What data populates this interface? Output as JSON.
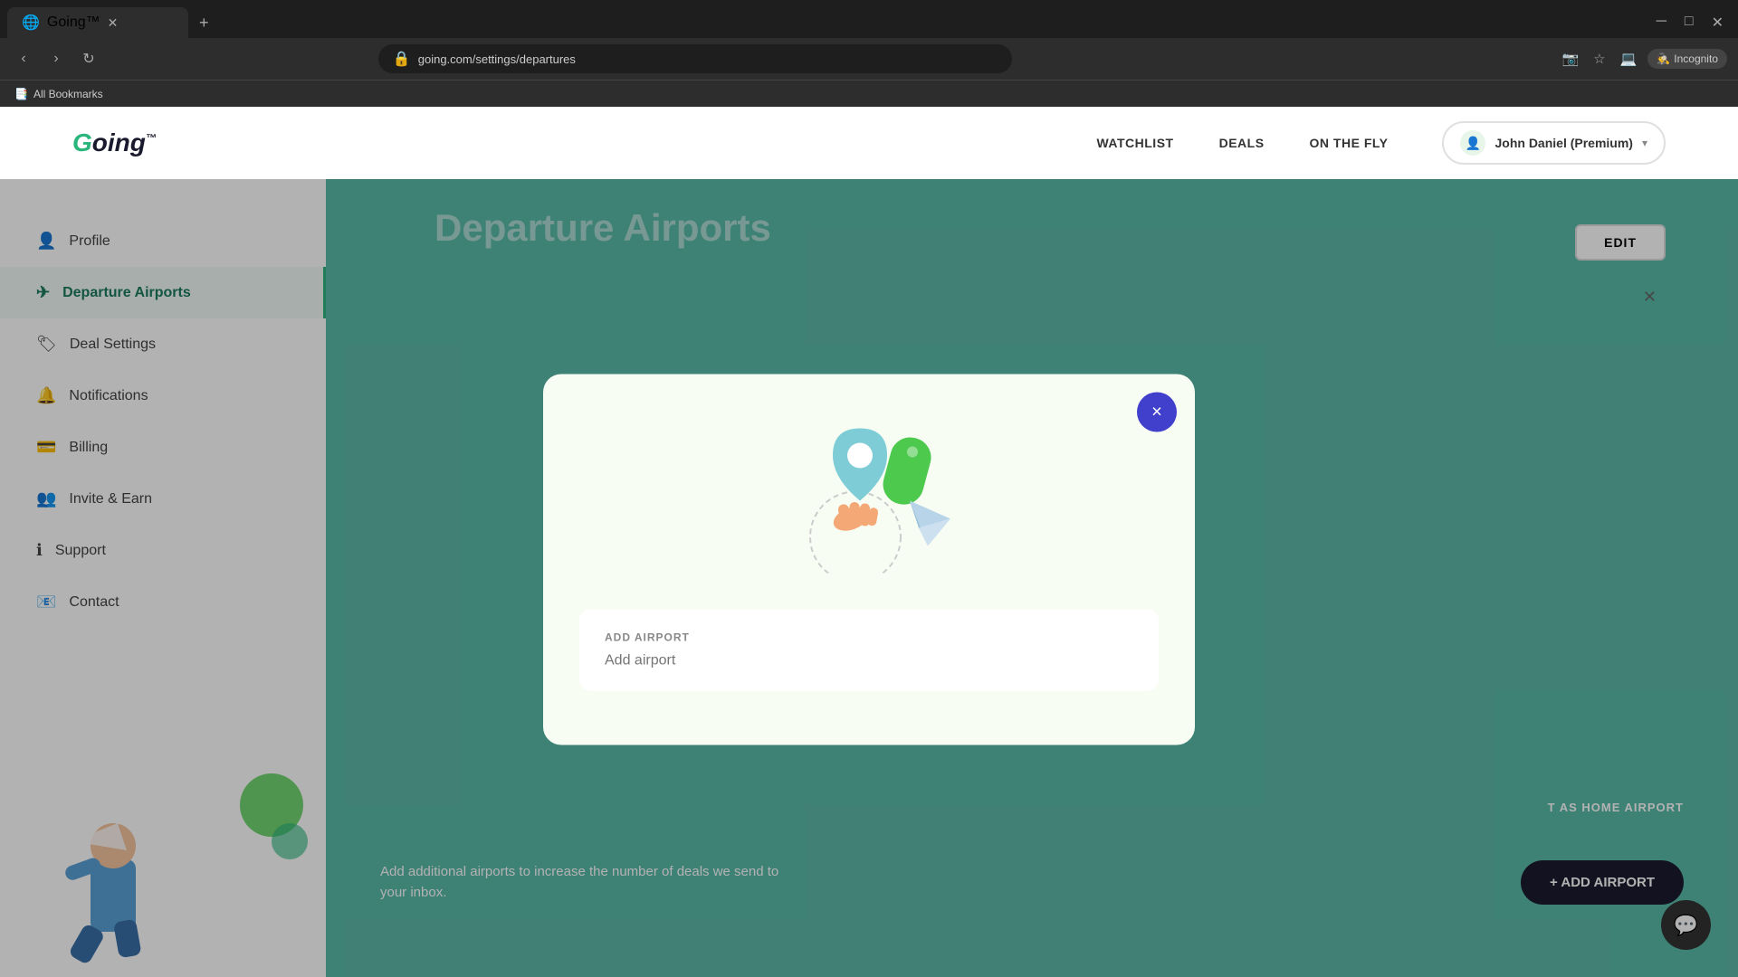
{
  "browser": {
    "tab_title": "Going™",
    "url": "going.com/settings/departures",
    "bookmarks_label": "All Bookmarks",
    "incognito_label": "Incognito"
  },
  "header": {
    "logo": "Going™",
    "nav": {
      "watchlist": "WATCHLIST",
      "deals": "DEALS",
      "on_the_fly": "ON THE FLY"
    },
    "user": {
      "name": "John Daniel",
      "plan": "(Premium)"
    }
  },
  "sidebar": {
    "items": [
      {
        "id": "profile",
        "label": "Profile",
        "icon": "👤"
      },
      {
        "id": "departure-airports",
        "label": "Departure Airports",
        "icon": "✈"
      },
      {
        "id": "deal-settings",
        "label": "Deal Settings",
        "icon": "🏷"
      },
      {
        "id": "notifications",
        "label": "Notifications",
        "icon": "🔔"
      },
      {
        "id": "billing",
        "label": "Billing",
        "icon": "💳"
      },
      {
        "id": "invite-earn",
        "label": "Invite & Earn",
        "icon": "👥"
      },
      {
        "id": "support",
        "label": "Support",
        "icon": "ℹ"
      },
      {
        "id": "contact",
        "label": "Contact",
        "icon": "📧"
      }
    ]
  },
  "main": {
    "title": "Departure Airports",
    "edit_button": "EDIT",
    "home_airport_label": "T AS HOME AIRPORT",
    "add_airport_button": "+ ADD AIRPORT",
    "bottom_description": "Add additional airports to increase the number of deals we send to your inbox."
  },
  "modal": {
    "title": "ADD AIRPORT",
    "placeholder": "Add airport",
    "close_icon": "×"
  }
}
